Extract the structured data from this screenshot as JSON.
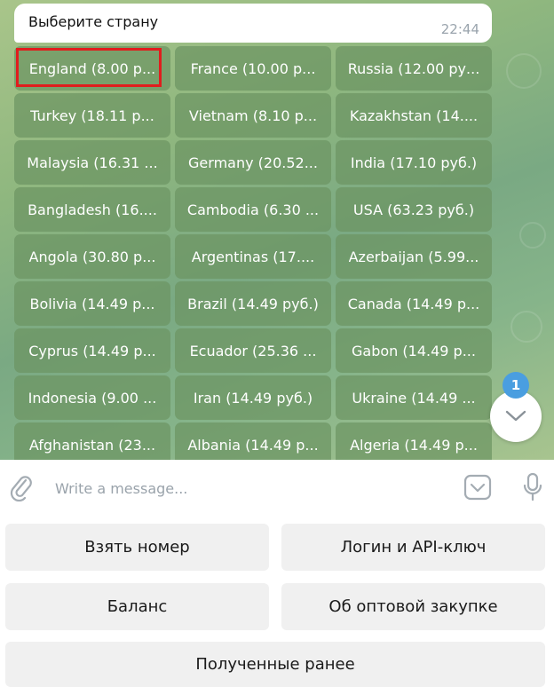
{
  "message": {
    "text": "Выберите страну",
    "time": "22:44"
  },
  "inline_keyboard": [
    [
      "England (8.00 р...",
      "France (10.00 р...",
      "Russia (12.00 ру..."
    ],
    [
      "Turkey (18.11 р...",
      "Vietnam (8.10 р...",
      "Kazakhstan (14...."
    ],
    [
      "Malaysia (16.31 ...",
      "Germany (20.52...",
      "India (17.10 руб.)"
    ],
    [
      "Bangladesh (16....",
      "Cambodia (6.30 ...",
      "USA (63.23 руб.)"
    ],
    [
      "Angola (30.80 р...",
      "Argentinas (17....",
      "Azerbaijan (5.99..."
    ],
    [
      "Bolivia (14.49 р...",
      "Brazil (14.49 руб.)",
      "Canada (14.49 р..."
    ],
    [
      "Cyprus (14.49 р...",
      "Ecuador (25.36 ...",
      "Gabon (14.49 р..."
    ],
    [
      "Indonesia (9.00 ...",
      "Iran (14.49 руб.)",
      "Ukraine (14.49 ..."
    ],
    [
      "Afghanistan (23...",
      "Albania (14.49 р...",
      "Algeria (14.49 р..."
    ]
  ],
  "scroll_button": {
    "badge": "1",
    "icon": "chevron-down-icon"
  },
  "composer": {
    "placeholder": "Write a message...",
    "attach_icon": "paperclip-icon",
    "emoji_icon": "emoji-icon",
    "mic_icon": "microphone-icon"
  },
  "reply_keyboard": {
    "take_number": "Взять номер",
    "login_api": "Логин и API-ключ",
    "balance": "Баланс",
    "wholesale": "Об оптовой закупке",
    "received_earlier": "Полученные ранее"
  },
  "colors": {
    "highlight": "#e11d1d",
    "badge": "#4a9ee0",
    "keyboard_button": "#6c9462"
  }
}
